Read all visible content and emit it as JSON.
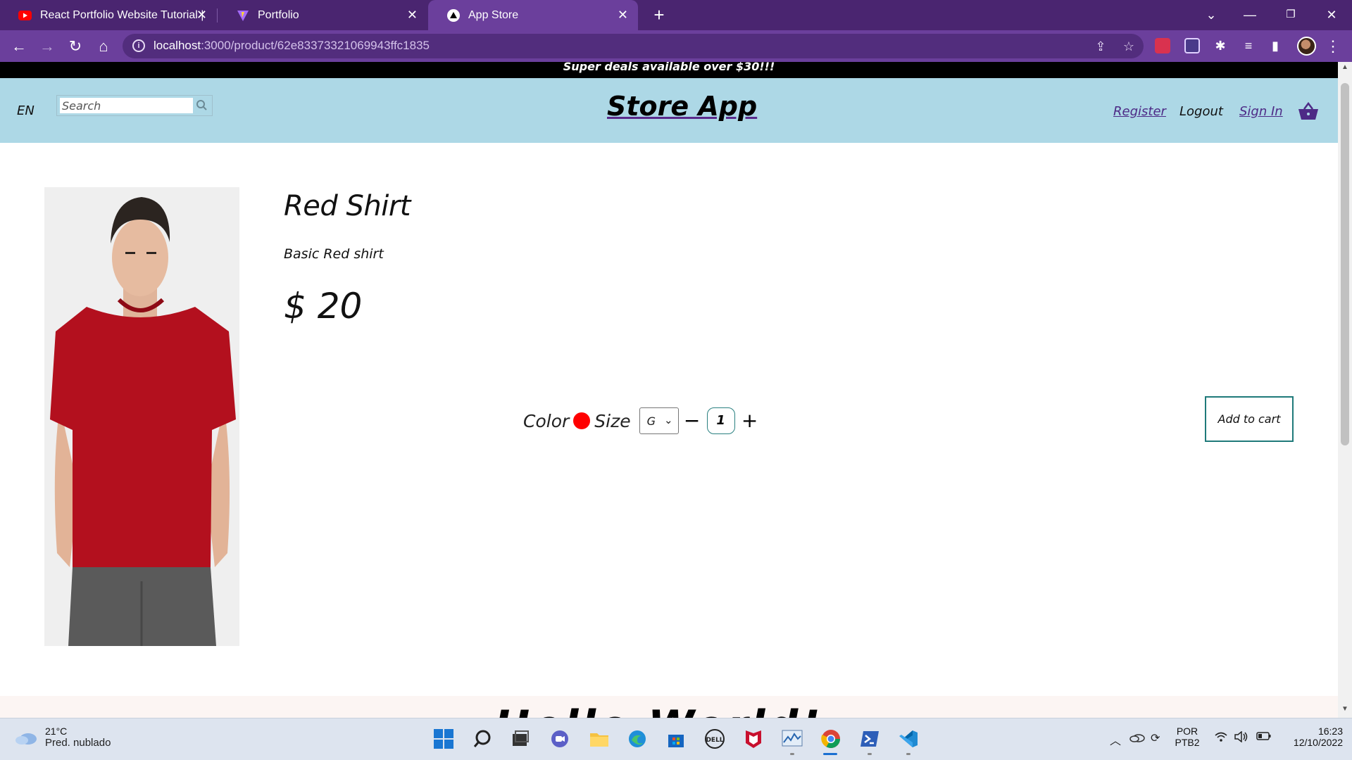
{
  "browser": {
    "tabs": [
      {
        "title": "React Portfolio Website Tutorial |",
        "favicon": "youtube-icon",
        "active": false
      },
      {
        "title": "Portfolio",
        "favicon": "vite-icon",
        "active": false
      },
      {
        "title": "App Store",
        "favicon": "app-icon",
        "active": true
      }
    ],
    "url_host": "localhost",
    "url_path": ":3000/product/62e83373321069943ffc1835"
  },
  "announcement": "Super deals available over $30!!!",
  "navbar": {
    "lang": "EN",
    "search_placeholder": "Search",
    "brand": "Store App",
    "links": {
      "register": "Register",
      "logout": "Logout",
      "signin": "Sign In"
    }
  },
  "product": {
    "title": "Red Shirt",
    "description": "Basic Red shirt",
    "price": "$ 20",
    "color_label": "Color",
    "color_value": "#ff0000",
    "size_label": "Size",
    "size_selected": "G",
    "minus": "−",
    "quantity": "1",
    "plus": "+",
    "add_to_cart": "Add to cart"
  },
  "newsletter_heading": "Hello World!",
  "taskbar": {
    "weather_temp": "21°C",
    "weather_desc": "Pred. nublado",
    "lang_top": "POR",
    "lang_bottom": "PTB2",
    "time": "16:23",
    "date": "12/10/2022"
  }
}
